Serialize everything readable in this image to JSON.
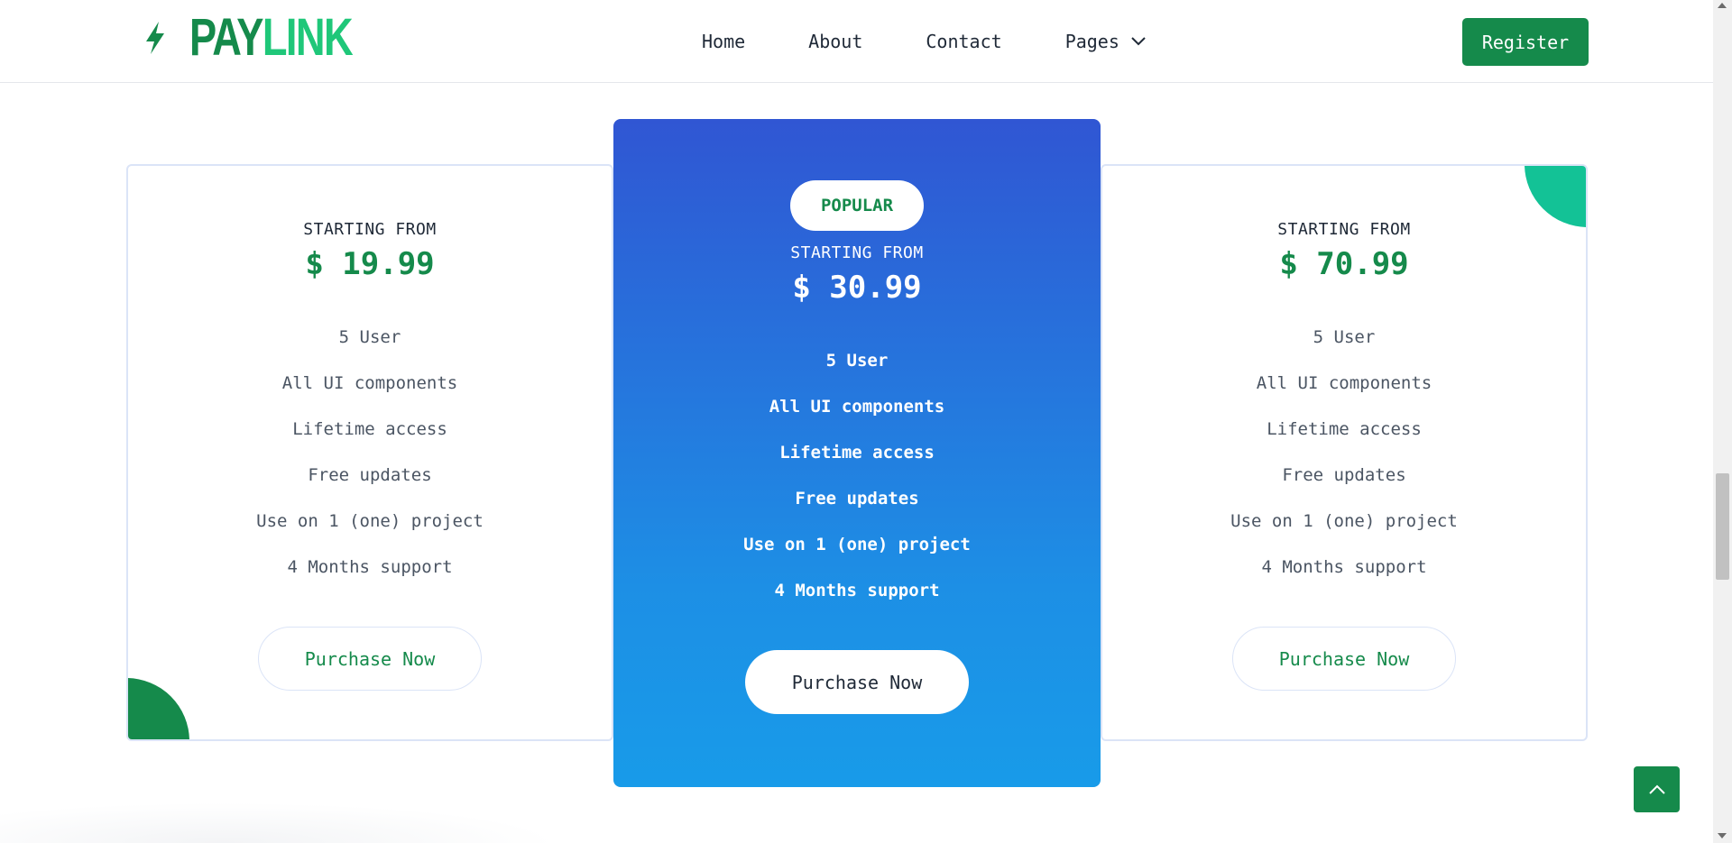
{
  "header": {
    "logo": {
      "part1": "PAY",
      "part2": "LINK",
      "icon": "bolt-icon"
    },
    "nav": [
      {
        "label": "Home"
      },
      {
        "label": "About"
      },
      {
        "label": "Contact"
      },
      {
        "label": "Pages",
        "icon": "chevron-down-icon"
      }
    ],
    "register_label": "Register"
  },
  "plans": [
    {
      "starting_label": "STARTING FROM",
      "price": "$ 19.99",
      "features": [
        "5 User",
        "All UI components",
        "Lifetime access",
        "Free updates",
        "Use on 1 (one) project",
        "4 Months support"
      ],
      "button_label": "Purchase Now"
    },
    {
      "badge": "POPULAR",
      "starting_label": "STARTING FROM",
      "price": "$ 30.99",
      "features": [
        "5 User",
        "All UI components",
        "Lifetime access",
        "Free updates",
        "Use on 1 (one) project",
        "4 Months support"
      ],
      "button_label": "Purchase Now"
    },
    {
      "starting_label": "STARTING FROM",
      "price": "$ 70.99",
      "features": [
        "5 User",
        "All UI components",
        "Lifetime access",
        "Free updates",
        "Use on 1 (one) project",
        "4 Months support"
      ],
      "button_label": "Purchase Now"
    }
  ],
  "back_to_top": {
    "icon": "chevron-up-icon"
  },
  "colors": {
    "brand_green": "#158a4b",
    "brand_light_green": "#1fc779",
    "accent_teal": "#13c296",
    "popular_gradient_top": "#3056d3",
    "popular_gradient_bottom": "#189be9"
  }
}
